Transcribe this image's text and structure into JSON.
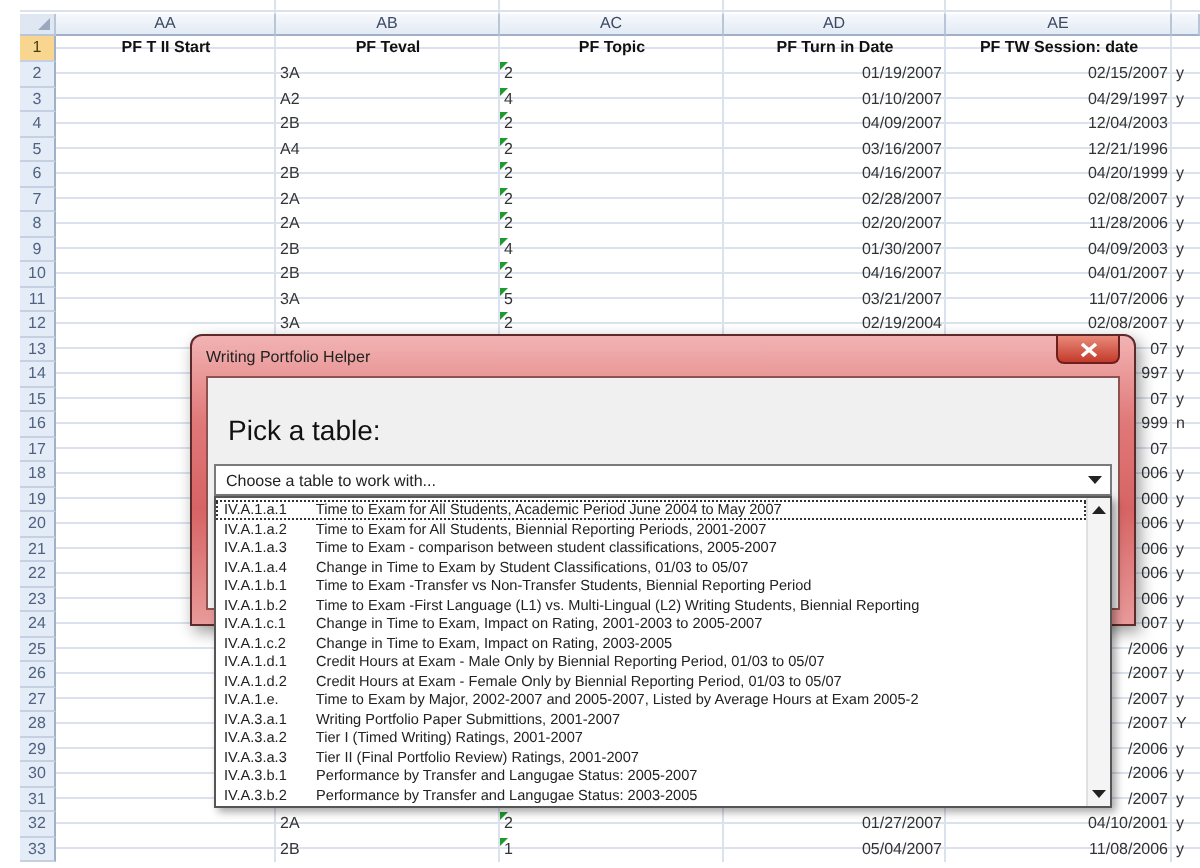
{
  "sheet": {
    "columns": [
      "AA",
      "AB",
      "AC",
      "AD",
      "AE"
    ],
    "rows": [
      {
        "number": "1",
        "selected": true,
        "kind": "header",
        "aa": "PF T II Start",
        "ab": "PF Teval",
        "ac": "PF Topic",
        "ad": "PF Turn in Date",
        "ae": "PF TW Session: date"
      },
      {
        "number": "2",
        "selected": false,
        "kind": "data",
        "ab": "3A",
        "ac": "2",
        "ac_flag": true,
        "ad": "01/19/2007",
        "ae": "02/15/2007",
        "column_6": "y"
      },
      {
        "number": "3",
        "selected": false,
        "kind": "data",
        "ab": "A2",
        "ac": "4",
        "ac_flag": true,
        "ad": "01/10/2007",
        "ae": "04/29/1997",
        "column_6": "y"
      },
      {
        "number": "4",
        "selected": false,
        "kind": "data",
        "ab": "2B",
        "ac": "2",
        "ac_flag": true,
        "ad": "04/09/2007",
        "ae": "12/04/2003"
      },
      {
        "number": "5",
        "selected": false,
        "kind": "data",
        "ab": "A4",
        "ac": "2",
        "ac_flag": true,
        "ad": "03/16/2007",
        "ae": "12/21/1996"
      },
      {
        "number": "6",
        "selected": false,
        "kind": "data",
        "ab": "2B",
        "ac": "2",
        "ac_flag": true,
        "ad": "04/16/2007",
        "ae": "04/20/1999",
        "column_6": "y"
      },
      {
        "number": "7",
        "selected": false,
        "kind": "data",
        "ab": "2A",
        "ac": "2",
        "ac_flag": true,
        "ad": "02/28/2007",
        "ae": "02/08/2007",
        "column_6": "y"
      },
      {
        "number": "8",
        "selected": false,
        "kind": "data",
        "ab": "2A",
        "ac": "2",
        "ac_flag": true,
        "ad": "02/20/2007",
        "ae": "11/28/2006",
        "column_6": "y"
      },
      {
        "number": "9",
        "selected": false,
        "kind": "data",
        "ab": "2B",
        "ac": "4",
        "ac_flag": true,
        "ad": "01/30/2007",
        "ae": "04/09/2003",
        "column_6": "y"
      },
      {
        "number": "10",
        "selected": false,
        "kind": "data",
        "ab": "2B",
        "ac": "2",
        "ac_flag": true,
        "ad": "04/16/2007",
        "ae": "04/01/2007",
        "column_6": "y"
      },
      {
        "number": "11",
        "selected": false,
        "kind": "data",
        "ab": "3A",
        "ac": "5",
        "ac_flag": true,
        "ad": "03/21/2007",
        "ae": "11/07/2006",
        "column_6": "y"
      },
      {
        "number": "12",
        "selected": false,
        "kind": "data",
        "ab": "3A",
        "ac": "2",
        "ac_flag": true,
        "ad": "02/19/2004",
        "ae": "02/08/2007",
        "column_6": "y"
      },
      {
        "number": "13",
        "selected": false,
        "kind": "data",
        "ae": "07",
        "column_6": "y"
      },
      {
        "number": "14",
        "selected": false,
        "kind": "data",
        "ae": "997",
        "column_6": "y"
      },
      {
        "number": "15",
        "selected": false,
        "kind": "data",
        "ae": "07",
        "column_6": "y"
      },
      {
        "number": "16",
        "selected": false,
        "kind": "data",
        "ae": "999",
        "column_6": "n"
      },
      {
        "number": "17",
        "selected": false,
        "kind": "data",
        "ae": "07"
      },
      {
        "number": "18",
        "selected": false,
        "kind": "data",
        "ae": "006",
        "column_6": "y"
      },
      {
        "number": "19",
        "selected": false,
        "kind": "data",
        "ae": "000",
        "column_6": "y"
      },
      {
        "number": "20",
        "selected": false,
        "kind": "data",
        "ae": "006",
        "column_6": "y"
      },
      {
        "number": "21",
        "selected": false,
        "kind": "data",
        "ae": "006",
        "column_6": "y"
      },
      {
        "number": "22",
        "selected": false,
        "kind": "data",
        "ae": "006",
        "column_6": "y"
      },
      {
        "number": "23",
        "selected": false,
        "kind": "data",
        "ae": "006",
        "column_6": "y"
      },
      {
        "number": "24",
        "selected": false,
        "kind": "data",
        "ae": "007",
        "column_6": "y"
      },
      {
        "number": "25",
        "selected": false,
        "kind": "data",
        "ae": "/2006",
        "column_6": "y"
      },
      {
        "number": "26",
        "selected": false,
        "kind": "data",
        "ae": "/2007",
        "column_6": "y"
      },
      {
        "number": "27",
        "selected": false,
        "kind": "data",
        "ae": "/2007",
        "column_6": "y"
      },
      {
        "number": "28",
        "selected": false,
        "kind": "data",
        "ae": "/2007",
        "column_6": "Y"
      },
      {
        "number": "29",
        "selected": false,
        "kind": "data",
        "ae": "/2006",
        "column_6": "y"
      },
      {
        "number": "30",
        "selected": false,
        "kind": "data",
        "ae": "/2006",
        "column_6": "y"
      },
      {
        "number": "31",
        "selected": false,
        "kind": "data",
        "ae": "/2007",
        "column_6": "y"
      },
      {
        "number": "32",
        "selected": false,
        "kind": "data",
        "ab": "2A",
        "ac": "2",
        "ac_flag": true,
        "ad": "01/27/2007",
        "ae": "04/10/2001",
        "column_6": "y"
      },
      {
        "number": "33",
        "selected": false,
        "kind": "data",
        "ab": "2B",
        "ac": "1",
        "ac_flag": true,
        "ad": "05/04/2007",
        "ae": "11/08/2006",
        "column_6": "y"
      }
    ]
  },
  "dialog": {
    "title": "Writing Portfolio Helper",
    "heading": "Pick a table:",
    "dropdown": {
      "value": "Choose a table to work with...",
      "expanded": true
    },
    "items": [
      {
        "code": "IV.A.1.a.1",
        "title": "Time to Exam for All Students, Academic Period June 2004 to May 2007",
        "selected": false,
        "focused": true
      },
      {
        "code": "IV.A.1.a.2",
        "title": "Time to Exam for All Students, Biennial Reporting Periods, 2001-2007",
        "selected": false,
        "focused": false
      },
      {
        "code": "IV.A.1.a.3",
        "title": "Time to Exam - comparison between student classifications, 2005-2007",
        "selected": false,
        "focused": false
      },
      {
        "code": "IV.A.1.a.4",
        "title": "Change in Time to Exam by Student Classifications, 01/03 to 05/07",
        "selected": false,
        "focused": false
      },
      {
        "code": "IV.A.1.b.1",
        "title": "Time to Exam -Transfer vs Non-Transfer Students, Biennial Reporting Period",
        "selected": false,
        "focused": false
      },
      {
        "code": "IV.A.1.b.2",
        "title": "Time to Exam -First Language (L1) vs. Multi-Lingual (L2) Writing Students, Biennial Reporting",
        "selected": false,
        "focused": false
      },
      {
        "code": "IV.A.1.c.1",
        "title": "Change in Time to Exam, Impact on Rating, 2001-2003 to 2005-2007",
        "selected": false,
        "focused": false
      },
      {
        "code": "IV.A.1.c.2",
        "title": "Change in Time to Exam, Impact on Rating, 2003-2005",
        "selected": false,
        "focused": false
      },
      {
        "code": "IV.A.1.d.1",
        "title": "Credit Hours at Exam - Male Only by Biennial Reporting Period, 01/03 to 05/07",
        "selected": false,
        "focused": false
      },
      {
        "code": "IV.A.1.d.2",
        "title": "Credit Hours at Exam - Female Only by Biennial Reporting Period, 01/03 to 05/07",
        "selected": false,
        "focused": false
      },
      {
        "code": "IV.A.1.e.",
        "title": "Time to Exam by Major, 2002-2007 and 2005-2007, Listed by Average Hours at Exam 2005-2",
        "selected": false,
        "focused": false
      },
      {
        "code": "IV.A.3.a.1",
        "title": "Writing Portfolio Paper Submittions, 2001-2007",
        "selected": false,
        "focused": false
      },
      {
        "code": "IV.A.3.a.2",
        "title": "Tier I (Timed Writing) Ratings, 2001-2007",
        "selected": false,
        "focused": false
      },
      {
        "code": "IV.A.3.a.3",
        "title": "Tier II (Final Portfolio Review) Ratings, 2001-2007",
        "selected": false,
        "focused": false
      },
      {
        "code": "IV.A.3.b.1",
        "title": "Performance by Transfer and Langugae Status: 2005-2007",
        "selected": false,
        "focused": false
      },
      {
        "code": "IV.A.3.b.2",
        "title": "Performance by Transfer and Langugae Status: 2003-2005",
        "selected": false,
        "focused": false
      }
    ]
  }
}
